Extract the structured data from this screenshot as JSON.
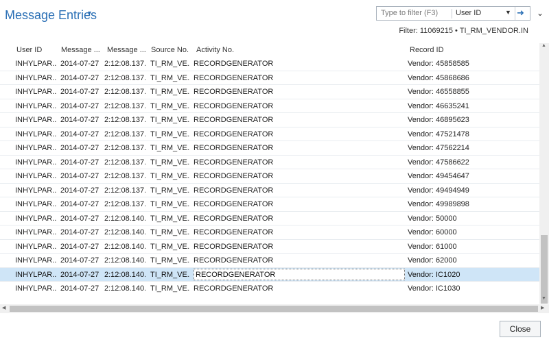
{
  "page": {
    "title": "Message Entries",
    "filter_placeholder": "Type to filter (F3)",
    "filter_field": "User ID",
    "filter_info": "Filter: 11069215 • TI_RM_VENDOR.IN"
  },
  "columns": [
    "User ID",
    "Message ...",
    "Message ...",
    "Source No.",
    "Activity No.",
    "Record ID"
  ],
  "rows": [
    {
      "uid": "INHYLPAR...",
      "d": "2014-07-27",
      "t": "2:12:08.137...",
      "src": "TI_RM_VE...",
      "act": "RECORDGENERATOR",
      "rec": "Vendor: 45858585"
    },
    {
      "uid": "INHYLPAR...",
      "d": "2014-07-27",
      "t": "2:12:08.137...",
      "src": "TI_RM_VE...",
      "act": "RECORDGENERATOR",
      "rec": "Vendor: 45868686"
    },
    {
      "uid": "INHYLPAR...",
      "d": "2014-07-27",
      "t": "2:12:08.137...",
      "src": "TI_RM_VE...",
      "act": "RECORDGENERATOR",
      "rec": "Vendor: 46558855"
    },
    {
      "uid": "INHYLPAR...",
      "d": "2014-07-27",
      "t": "2:12:08.137...",
      "src": "TI_RM_VE...",
      "act": "RECORDGENERATOR",
      "rec": "Vendor: 46635241"
    },
    {
      "uid": "INHYLPAR...",
      "d": "2014-07-27",
      "t": "2:12:08.137...",
      "src": "TI_RM_VE...",
      "act": "RECORDGENERATOR",
      "rec": "Vendor: 46895623"
    },
    {
      "uid": "INHYLPAR...",
      "d": "2014-07-27",
      "t": "2:12:08.137...",
      "src": "TI_RM_VE...",
      "act": "RECORDGENERATOR",
      "rec": "Vendor: 47521478"
    },
    {
      "uid": "INHYLPAR...",
      "d": "2014-07-27",
      "t": "2:12:08.137...",
      "src": "TI_RM_VE...",
      "act": "RECORDGENERATOR",
      "rec": "Vendor: 47562214"
    },
    {
      "uid": "INHYLPAR...",
      "d": "2014-07-27",
      "t": "2:12:08.137...",
      "src": "TI_RM_VE...",
      "act": "RECORDGENERATOR",
      "rec": "Vendor: 47586622"
    },
    {
      "uid": "INHYLPAR...",
      "d": "2014-07-27",
      "t": "2:12:08.137...",
      "src": "TI_RM_VE...",
      "act": "RECORDGENERATOR",
      "rec": "Vendor: 49454647"
    },
    {
      "uid": "INHYLPAR...",
      "d": "2014-07-27",
      "t": "2:12:08.137...",
      "src": "TI_RM_VE...",
      "act": "RECORDGENERATOR",
      "rec": "Vendor: 49494949"
    },
    {
      "uid": "INHYLPAR...",
      "d": "2014-07-27",
      "t": "2:12:08.137...",
      "src": "TI_RM_VE...",
      "act": "RECORDGENERATOR",
      "rec": "Vendor: 49989898"
    },
    {
      "uid": "INHYLPAR...",
      "d": "2014-07-27",
      "t": "2:12:08.140...",
      "src": "TI_RM_VE...",
      "act": "RECORDGENERATOR",
      "rec": "Vendor: 50000"
    },
    {
      "uid": "INHYLPAR...",
      "d": "2014-07-27",
      "t": "2:12:08.140...",
      "src": "TI_RM_VE...",
      "act": "RECORDGENERATOR",
      "rec": "Vendor: 60000"
    },
    {
      "uid": "INHYLPAR...",
      "d": "2014-07-27",
      "t": "2:12:08.140...",
      "src": "TI_RM_VE...",
      "act": "RECORDGENERATOR",
      "rec": "Vendor: 61000"
    },
    {
      "uid": "INHYLPAR...",
      "d": "2014-07-27",
      "t": "2:12:08.140...",
      "src": "TI_RM_VE...",
      "act": "RECORDGENERATOR",
      "rec": "Vendor: 62000"
    },
    {
      "uid": "INHYLPAR...",
      "d": "2014-07-27",
      "t": "2:12:08.140...",
      "src": "TI_RM_VE...",
      "act": "RECORDGENERATOR",
      "rec": "Vendor: IC1020",
      "selected": true
    },
    {
      "uid": "INHYLPAR...",
      "d": "2014-07-27",
      "t": "2:12:08.140...",
      "src": "TI_RM_VE...",
      "act": "RECORDGENERATOR",
      "rec": "Vendor: IC1030"
    }
  ],
  "footer": {
    "close_label": "Close"
  },
  "colors": {
    "accent": "#2a6fb5",
    "selected_row": "#cfe5f7"
  }
}
